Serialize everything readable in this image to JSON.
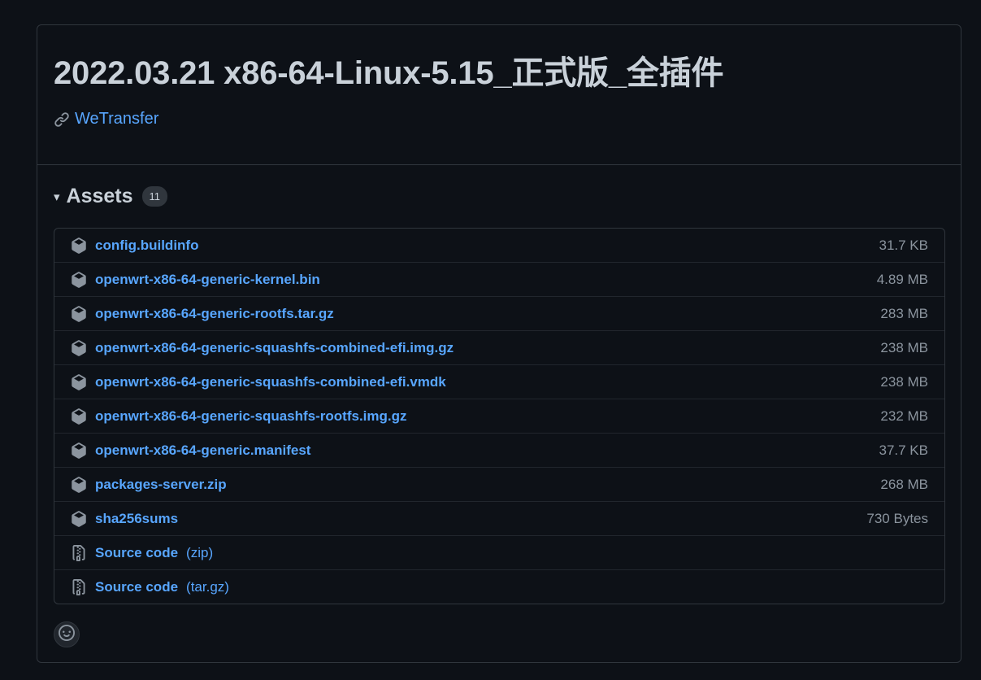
{
  "release": {
    "title": "2022.03.21 x86-64-Linux-5.15_正式版_全插件",
    "link_text": "WeTransfer",
    "link_icon": "link-icon"
  },
  "assets": {
    "caret": "▾",
    "title": "Assets",
    "count": "11",
    "items": [
      {
        "name": "config.buildinfo",
        "size": "31.7 KB",
        "icon": "package-icon"
      },
      {
        "name": "openwrt-x86-64-generic-kernel.bin",
        "size": "4.89 MB",
        "icon": "package-icon"
      },
      {
        "name": "openwrt-x86-64-generic-rootfs.tar.gz",
        "size": "283 MB",
        "icon": "package-icon"
      },
      {
        "name": "openwrt-x86-64-generic-squashfs-combined-efi.img.gz",
        "size": "238 MB",
        "icon": "package-icon"
      },
      {
        "name": "openwrt-x86-64-generic-squashfs-combined-efi.vmdk",
        "size": "238 MB",
        "icon": "package-icon"
      },
      {
        "name": "openwrt-x86-64-generic-squashfs-rootfs.img.gz",
        "size": "232 MB",
        "icon": "package-icon"
      },
      {
        "name": "openwrt-x86-64-generic.manifest",
        "size": "37.7 KB",
        "icon": "package-icon"
      },
      {
        "name": "packages-server.zip",
        "size": "268 MB",
        "icon": "package-icon"
      },
      {
        "name": "sha256sums",
        "size": "730 Bytes",
        "icon": "package-icon"
      }
    ],
    "source": [
      {
        "name": "Source code",
        "suffix": "(zip)",
        "icon": "file-zip-icon"
      },
      {
        "name": "Source code",
        "suffix": "(tar.gz)",
        "icon": "file-zip-icon"
      }
    ]
  },
  "reaction": {
    "icon": "smiley-icon"
  },
  "colors": {
    "background": "#0d1117",
    "border": "#30363d",
    "link": "#58a6ff",
    "text": "#c9d1d9",
    "muted": "#8b949e"
  }
}
